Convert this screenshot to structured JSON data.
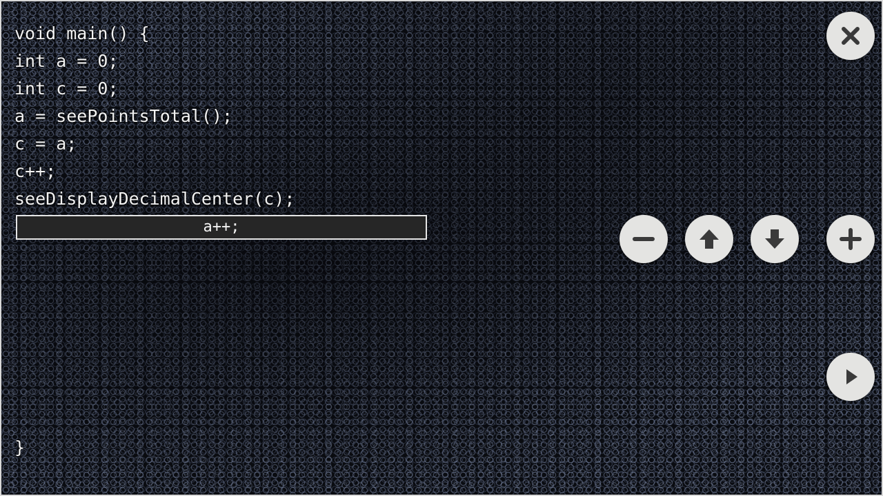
{
  "code": {
    "lines": [
      "void main() {",
      "int a = 0;",
      "int c = 0;",
      "a = seePointsTotal();",
      "c = a;",
      "c++;",
      "seeDisplayDecimalCenter(c);"
    ],
    "selected_line": "a++;",
    "closing_brace": "}"
  },
  "controls": {
    "close_icon": "close-icon",
    "remove_icon": "minus-icon",
    "move_up_icon": "arrow-up-icon",
    "move_down_icon": "arrow-down-icon",
    "add_icon": "plus-icon",
    "run_icon": "play-icon"
  },
  "colors": {
    "button_fill": "#e4e4e2",
    "icon_color": "#3a3a3a",
    "code_text": "#f2f2f2",
    "selection_fill": "#262626"
  }
}
